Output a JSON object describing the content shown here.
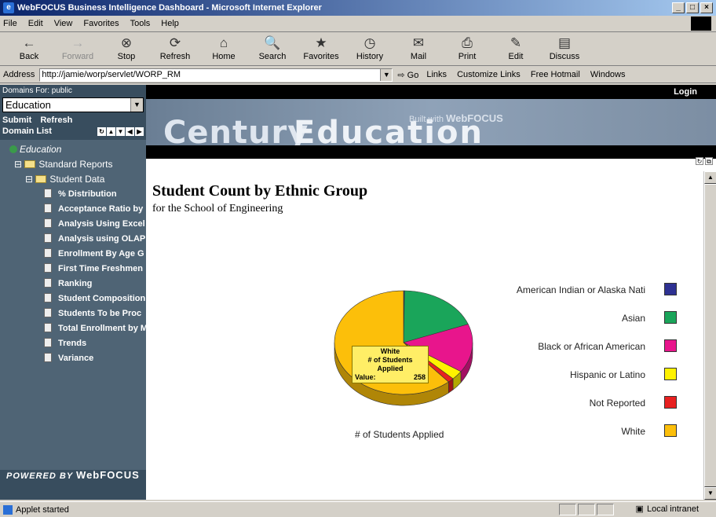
{
  "window": {
    "title": "WebFOCUS Business Intelligence Dashboard - Microsoft Internet Explorer",
    "min": "_",
    "max": "□",
    "close": "×"
  },
  "menu": [
    "File",
    "Edit",
    "View",
    "Favorites",
    "Tools",
    "Help"
  ],
  "toolbar": [
    {
      "label": "Back",
      "icon": "←",
      "enabled": true
    },
    {
      "label": "Forward",
      "icon": "→",
      "enabled": false
    },
    {
      "label": "Stop",
      "icon": "⊗",
      "enabled": true
    },
    {
      "label": "Refresh",
      "icon": "⟳",
      "enabled": true
    },
    {
      "label": "Home",
      "icon": "⌂",
      "enabled": true
    },
    {
      "label": "Search",
      "icon": "🔍",
      "enabled": true
    },
    {
      "label": "Favorites",
      "icon": "★",
      "enabled": true
    },
    {
      "label": "History",
      "icon": "◷",
      "enabled": true
    },
    {
      "label": "Mail",
      "icon": "✉",
      "enabled": true
    },
    {
      "label": "Print",
      "icon": "⎙",
      "enabled": true
    },
    {
      "label": "Edit",
      "icon": "✎",
      "enabled": true
    },
    {
      "label": "Discuss",
      "icon": "▤",
      "enabled": true
    }
  ],
  "address": {
    "label": "Address",
    "url": "http://jamie/worp/servlet/WORP_RM",
    "go": "Go",
    "links": [
      "Links",
      "Customize Links",
      "Free Hotmail",
      "Windows"
    ]
  },
  "sidebar": {
    "domains_label": "Domains For: public",
    "domain_selected": "Education",
    "submit": "Submit",
    "refresh": "Refresh",
    "domain_list": "Domain List",
    "tree_root": "Education",
    "folder1": "Standard Reports",
    "folder2": "Student Data",
    "reports": [
      "% Distribution",
      "Acceptance Ratio by",
      "Analysis Using Excel",
      "Analysis using OLAP",
      "Enrollment By Age G",
      "First Time Freshmen",
      "Ranking",
      "Student Composition",
      "Students To be Proc",
      "Total Enrollment by M",
      "Trends",
      "Variance"
    ],
    "powered_prefix": "POWERED BY",
    "powered_brand": "WebFOCUS"
  },
  "banner": {
    "login": "Login",
    "century": "Century",
    "education": "Education",
    "built_prefix": "Built with",
    "built_brand": "WebFOCUS"
  },
  "report": {
    "title": "Student Count by Ethnic Group",
    "subtitle": "for the School of Engineering"
  },
  "chart_data": {
    "type": "pie",
    "xlabel": "# of Students Applied",
    "categories": [
      "American Indian or Alaska Nati",
      "Asian",
      "Black or African American",
      "Hispanic or Latino",
      "Not Reported",
      "White"
    ],
    "values": [
      1,
      80,
      64,
      12,
      6,
      258
    ],
    "colors": [
      "#2e3192",
      "#1aa55a",
      "#e8158c",
      "#fff200",
      "#e82020",
      "#fcbf0a"
    ],
    "tooltip": {
      "category": "White",
      "measure": "# of Students Applied",
      "value_label": "Value:",
      "value": "258"
    }
  },
  "status": {
    "text": "Applet started",
    "zone": "Local intranet"
  }
}
